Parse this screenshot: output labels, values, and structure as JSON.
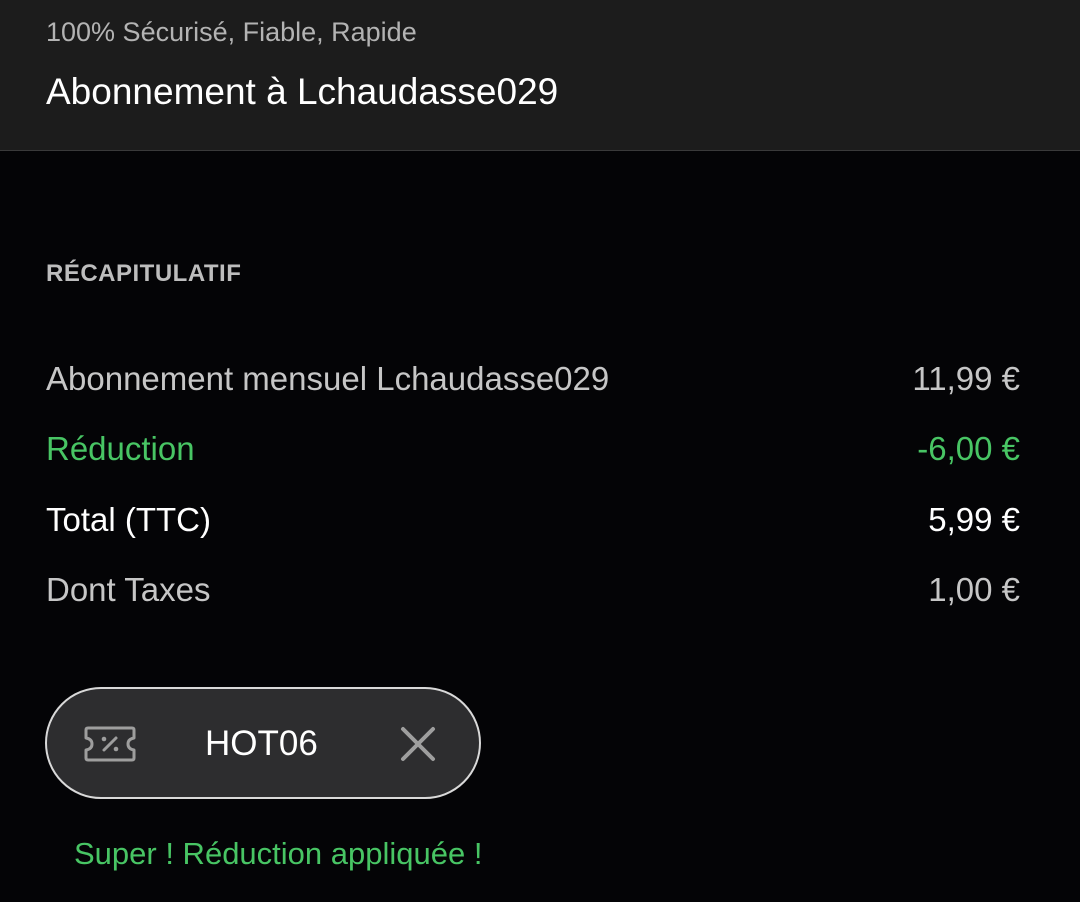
{
  "header": {
    "tagline": "100% Sécurisé, Fiable, Rapide",
    "title": "Abonnement à Lchaudasse029"
  },
  "summary": {
    "label": "RÉCAPITULATIF",
    "rows": [
      {
        "label": "Abonnement mensuel Lchaudasse029",
        "value": "11,99 €"
      },
      {
        "label": "Réduction",
        "value": "-6,00 €"
      },
      {
        "label": "Total (TTC)",
        "value": "5,99 €"
      },
      {
        "label": "Dont Taxes",
        "value": "1,00 €"
      }
    ]
  },
  "coupon": {
    "code": "HOT06",
    "icon": "discount-ticket-icon",
    "remove_icon": "close-icon"
  },
  "message": "Super ! Réduction appliquée !",
  "colors": {
    "header_bg": "#1c1c1c",
    "page_bg": "#040406",
    "accent_green": "#48c564",
    "coupon_bg": "#2d2d2f"
  }
}
